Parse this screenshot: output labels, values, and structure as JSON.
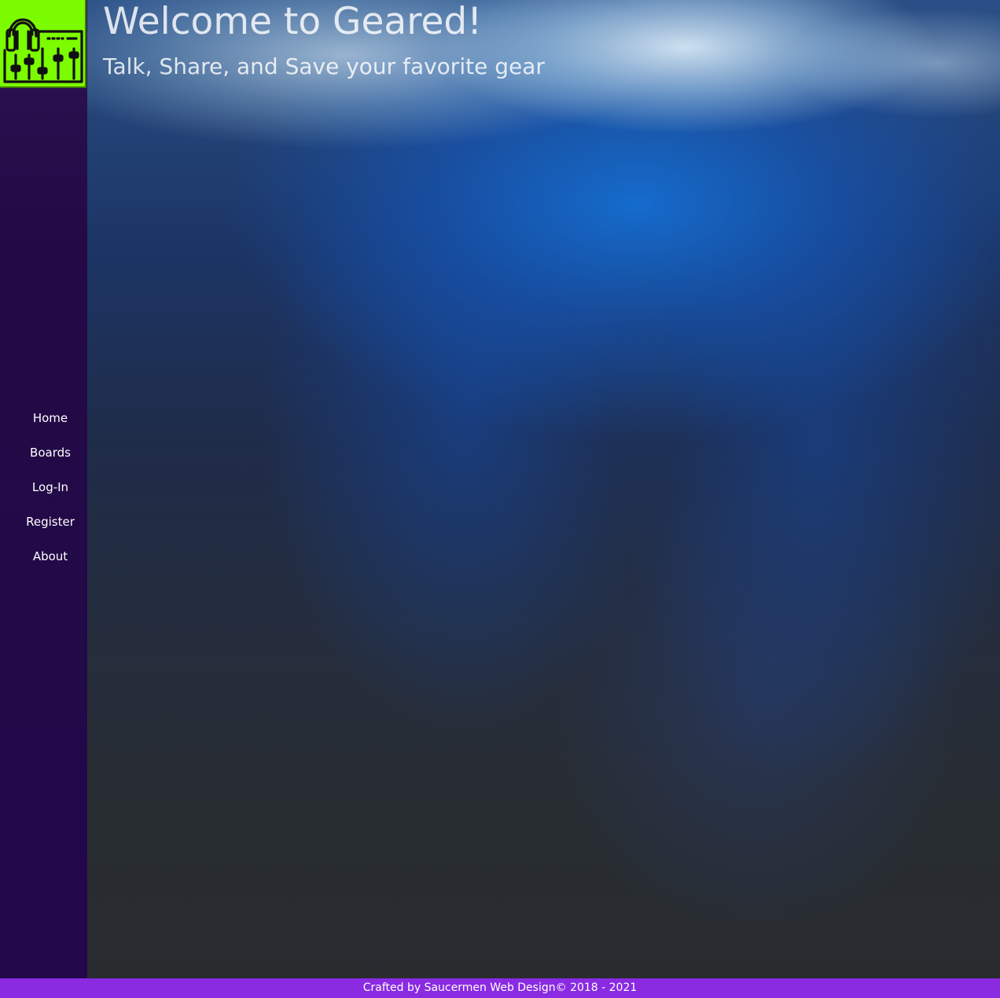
{
  "logo": {
    "icon": "headphones-mixer-icon",
    "background_color": "#7cfc00"
  },
  "hero": {
    "title": "Welcome to Geared!",
    "subtitle": "Talk, Share, and Save your favorite gear"
  },
  "sidebar": {
    "background_color": "#22084a",
    "items": [
      {
        "label": "Home"
      },
      {
        "label": "Boards"
      },
      {
        "label": "Log-In"
      },
      {
        "label": "Register"
      },
      {
        "label": "About"
      }
    ]
  },
  "footer": {
    "text": "Crafted by Saucermen Web Design© 2018 - 2021",
    "background_color": "#8a2be2"
  }
}
